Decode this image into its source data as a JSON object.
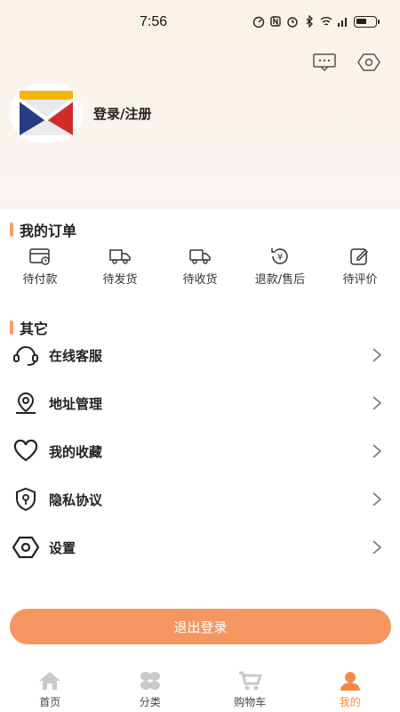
{
  "status_bar": {
    "time": "7:56"
  },
  "header": {
    "message_icon": "message-icon",
    "settings_icon": "settings-hex-icon"
  },
  "profile": {
    "login_label": "登录/注册"
  },
  "orders_section": {
    "title": "我的订单",
    "items": [
      {
        "label": "待付款",
        "icon": "wallet-icon"
      },
      {
        "label": "待发货",
        "icon": "truck-icon"
      },
      {
        "label": "待收货",
        "icon": "delivery-truck-icon"
      },
      {
        "label": "退款/售后",
        "icon": "refund-icon"
      },
      {
        "label": "待评价",
        "icon": "edit-icon"
      }
    ]
  },
  "other_section": {
    "title": "其它",
    "items": [
      {
        "label": "在线客服",
        "icon": "headset-icon"
      },
      {
        "label": "地址管理",
        "icon": "location-icon"
      },
      {
        "label": "我的收藏",
        "icon": "heart-icon"
      },
      {
        "label": "隐私协议",
        "icon": "shield-icon"
      },
      {
        "label": "设置",
        "icon": "settings-icon"
      }
    ]
  },
  "logout_label": "退出登录",
  "tabbar": {
    "items": [
      {
        "label": "首页",
        "icon": "home-icon"
      },
      {
        "label": "分类",
        "icon": "category-icon"
      },
      {
        "label": "购物车",
        "icon": "cart-icon"
      },
      {
        "label": "我的",
        "icon": "user-icon"
      }
    ],
    "active_index": 3
  },
  "colors": {
    "accent": "#f59660",
    "active_tab": "#f58a45",
    "section_bar": "#f4a26b"
  }
}
